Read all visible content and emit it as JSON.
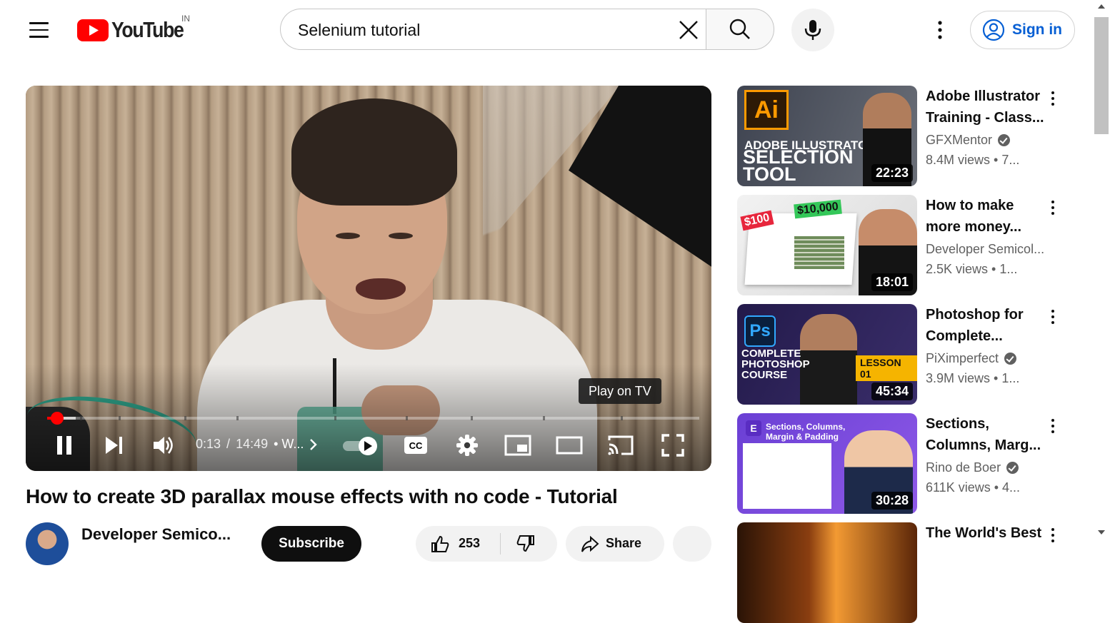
{
  "header": {
    "logo_text": "YouTube",
    "country_code": "IN",
    "search": {
      "value": "Selenium tutorial"
    },
    "sign_in_label": "Sign in"
  },
  "player": {
    "tooltip": "Play on TV",
    "current_time": "0:13",
    "time_separator": "/",
    "duration": "14:49",
    "chapter": "• W...",
    "progress": 0.015,
    "state": "playing",
    "autoplay_on": true
  },
  "video": {
    "title": "How to create 3D parallax mouse effects with no code - Tutorial",
    "channel": "Developer Semico...",
    "subscribe_label": "Subscribe",
    "like_count": "253",
    "share_label": "Share"
  },
  "recommendations": [
    {
      "title_lines": [
        "Adobe Illustrator",
        "Training - Class..."
      ],
      "channel": "GFXMentor",
      "verified": true,
      "meta": "8.4M views  • 7...",
      "duration": "22:23",
      "thumb_text": [
        "Ai",
        "ADOBE ILLUSTRATOR",
        "SELECTION",
        "TOOL"
      ]
    },
    {
      "title_lines": [
        "How to make",
        "more money..."
      ],
      "channel": "Developer Semicol...",
      "verified": false,
      "meta": "2.5K views  • 1...",
      "duration": "18:01",
      "thumb_text": [
        "$100",
        "$10,000"
      ]
    },
    {
      "title_lines": [
        "Photoshop for",
        "Complete..."
      ],
      "channel": "PiXimperfect",
      "verified": true,
      "meta": "3.9M views  • 1...",
      "duration": "45:34",
      "thumb_text": [
        "Ps",
        "COMPLETE",
        "PHOTOSHOP",
        "COURSE",
        "LESSON 01"
      ]
    },
    {
      "title_lines": [
        "Sections,",
        "Columns, Marg..."
      ],
      "channel": "Rino de Boer",
      "verified": true,
      "meta": "611K views  • 4...",
      "duration": "30:28",
      "thumb_text": [
        "E",
        "Sections, Columns,",
        "Margin & Padding"
      ]
    },
    {
      "title_lines": [
        "The World's Best"
      ],
      "channel": "",
      "verified": false,
      "meta": "",
      "duration": "",
      "thumb_text": []
    }
  ],
  "colors": {
    "brand_red": "#ff0000",
    "link_blue": "#065fd4",
    "text_primary": "#0f0f0f",
    "text_secondary": "#606060"
  },
  "icons": [
    "menu-icon",
    "youtube-logo-icon",
    "close-icon",
    "search-icon",
    "mic-icon",
    "more-vert-icon",
    "account-icon",
    "pause-icon",
    "next-icon",
    "volume-icon",
    "chevron-right-icon",
    "autoplay-play-icon",
    "captions-icon",
    "settings-icon",
    "miniplayer-icon",
    "theater-icon",
    "cast-icon",
    "fullscreen-icon",
    "like-icon",
    "dislike-icon",
    "share-icon",
    "verified-icon"
  ]
}
